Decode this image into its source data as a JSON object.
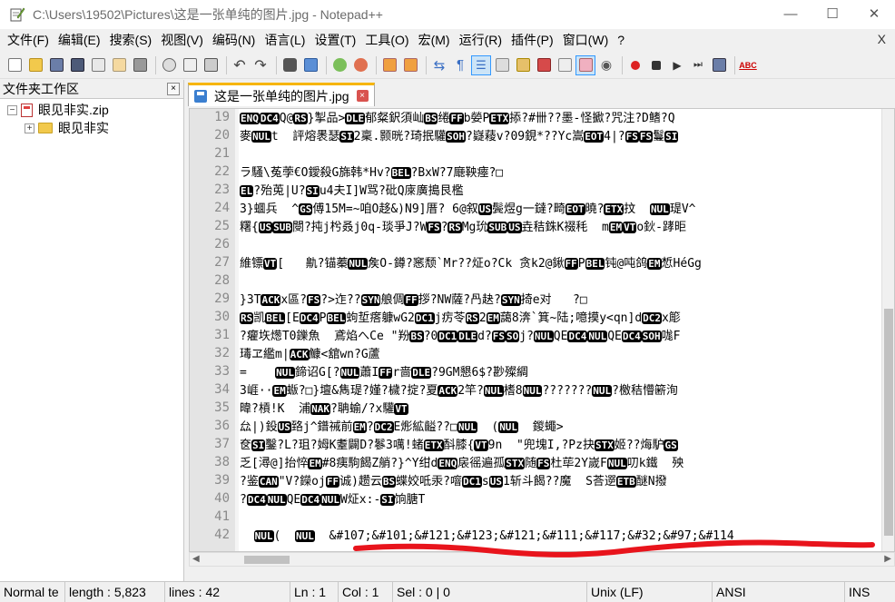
{
  "window": {
    "title": "C:\\Users\\19502\\Pictures\\这是一张单纯的图片.jpg - Notepad++",
    "minimize": "—",
    "maximize": "☐",
    "close": "✕"
  },
  "menu": {
    "items": [
      "文件(F)",
      "编辑(E)",
      "搜索(S)",
      "视图(V)",
      "编码(N)",
      "语言(L)",
      "设置(T)",
      "工具(O)",
      "宏(M)",
      "运行(R)",
      "插件(P)",
      "窗口(W)",
      "?"
    ],
    "close": "X"
  },
  "toolbar": {
    "icons": [
      "new-file-icon",
      "open-file-icon",
      "save-icon",
      "save-all-icon",
      "close-icon",
      "close-all-icon",
      "print-icon",
      "cut-icon",
      "copy-icon",
      "paste-icon",
      "undo-icon",
      "redo-icon",
      "find-icon",
      "replace-icon",
      "zoom-in-icon",
      "zoom-out-icon",
      "sync-vertical-icon",
      "sync-horizontal-icon",
      "word-wrap-icon",
      "show-all-chars-icon",
      "indent-guide-icon",
      "language-icon",
      "document-map-icon",
      "function-list-icon",
      "folder-workspace-icon",
      "monitor-icon",
      "record-macro-icon",
      "stop-macro-icon",
      "play-macro-icon",
      "run-macro-multiple-icon",
      "save-macro-icon",
      "spell-check-icon"
    ],
    "spell_label": "ABC"
  },
  "left_panel": {
    "title": "文件夹工作区",
    "close": "×",
    "tree": [
      {
        "label": "眼见非实.zip",
        "expander": "−",
        "type": "zip"
      },
      {
        "label": "眼见非实",
        "expander": "+",
        "type": "folder"
      }
    ]
  },
  "tab": {
    "label": "这是一张单纯的图片.jpg",
    "close": "×"
  },
  "editor": {
    "line_numbers": [
      "19",
      "20",
      "21",
      "22",
      "23",
      "24",
      "25",
      "26",
      "27",
      "28",
      "29",
      "30",
      "31",
      "32",
      "33",
      "34",
      "35",
      "36",
      "37",
      "38",
      "39",
      "40",
      "41",
      "42"
    ],
    "lines": [
      [
        {
          "t": "ENQ",
          "c": 1
        },
        {
          "t": "DC4",
          "c": 1
        },
        {
          "t": "Q@"
        },
        {
          "t": "RS",
          "c": 1
        },
        {
          "t": "}掣品>"
        },
        {
          "t": "DLE",
          "c": 1
        },
        {
          "t": "郁粲鈬須屾"
        },
        {
          "t": "BS",
          "c": 1
        },
        {
          "t": "绻"
        },
        {
          "t": "FF",
          "c": 1
        },
        {
          "t": "b嫈P"
        },
        {
          "t": "ETX",
          "c": 1
        },
        {
          "t": "掭?#卌??墨-怪擨?咒注?D鳍?Q"
        }
      ],
      [
        {
          "t": "麥"
        },
        {
          "t": "NUL",
          "c": 1
        },
        {
          "t": "t  評熔褁瑟"
        },
        {
          "t": "SI",
          "c": 1
        },
        {
          "t": "2稟.颢晄?琦抿驩"
        },
        {
          "t": "SOH",
          "c": 1
        },
        {
          "t": "?嶷薐v?09鋧*??Yc嵩"
        },
        {
          "t": "EOT",
          "c": 1
        },
        {
          "t": "4|?"
        },
        {
          "t": "FS",
          "c": 1
        },
        {
          "t": "FS",
          "c": 1
        },
        {
          "t": "鬘"
        },
        {
          "t": "SI",
          "c": 1
        }
      ],
      [],
      [
        {
          "t": "ラ騷\\菟荸€O鑀殺G旆韩*Hv?"
        },
        {
          "t": "BEL",
          "c": 1
        },
        {
          "t": "?BxW?7廰鞅瘞?□"
        }
      ],
      [
        {
          "t": "EL",
          "c": 1
        },
        {
          "t": "?殆莵|U?"
        },
        {
          "t": "SI",
          "c": 1
        },
        {
          "t": "u4夫I]W骂?砒Q庲廣搗艮檻"
        }
      ],
      [
        {
          "t": "3}蜖兵  ^"
        },
        {
          "t": "GS",
          "c": 1
        },
        {
          "t": "傅15M=~咱O趍&)N9]厝? 6@叙"
        },
        {
          "t": "US",
          "c": 1
        },
        {
          "t": "鬓煜g一鐽?畸"
        },
        {
          "t": "EOT",
          "c": 1
        },
        {
          "t": "曉?"
        },
        {
          "t": "ETX",
          "c": 1
        },
        {
          "t": "抆  "
        },
        {
          "t": "NUL",
          "c": 1
        },
        {
          "t": "瑅V^"
        }
      ],
      [
        {
          "t": "糬{"
        },
        {
          "t": "US",
          "c": 1
        },
        {
          "t": "SUB",
          "c": 1
        },
        {
          "t": "閿?扽j枍叒j0q-琰爭J?W"
        },
        {
          "t": "FS",
          "c": 1
        },
        {
          "t": "?"
        },
        {
          "t": "RS",
          "c": 1
        },
        {
          "t": "Mg玧"
        },
        {
          "t": "SUB",
          "c": 1
        },
        {
          "t": "US",
          "c": 1
        },
        {
          "t": "垚秸銖K裰秏  m"
        },
        {
          "t": "EM",
          "c": 1
        },
        {
          "t": "VT",
          "c": 1
        },
        {
          "t": "o鈥-踍昛"
        }
      ],
      [],
      [
        {
          "t": "維镖"
        },
        {
          "t": "VT",
          "c": 1
        },
        {
          "t": "[   鼽?锚蓁"
        },
        {
          "t": "NUL",
          "c": 1
        },
        {
          "t": "矦O-鐏?窸颓`Mr??炡o?Ck 贪k2@鍬"
        },
        {
          "t": "FF",
          "c": 1
        },
        {
          "t": "P"
        },
        {
          "t": "BEL",
          "c": 1
        },
        {
          "t": "钝@吨鸽"
        },
        {
          "t": "EM",
          "c": 1
        },
        {
          "t": "惁HéGg"
        }
      ],
      [],
      [
        {
          "t": "}3T"
        },
        {
          "t": "ACK",
          "c": 1
        },
        {
          "t": "x區?"
        },
        {
          "t": "FS",
          "c": 1
        },
        {
          "t": "?>迮??"
        },
        {
          "t": "SYN",
          "c": 1
        },
        {
          "t": "艆倜"
        },
        {
          "t": "FF",
          "c": 1
        },
        {
          "t": "拶?NW薩?冎赽?"
        },
        {
          "t": "SYN",
          "c": 1
        },
        {
          "t": "掎e对   ?□"
        }
      ],
      [
        {
          "t": "RS",
          "c": 1
        },
        {
          "t": "凯"
        },
        {
          "t": "BEL",
          "c": 1
        },
        {
          "t": "[E"
        },
        {
          "t": "DC4",
          "c": 1
        },
        {
          "t": "P"
        },
        {
          "t": "BEL",
          "c": 1
        },
        {
          "t": "蚼埑瘩躿wG2"
        },
        {
          "t": "DC1",
          "c": 1
        },
        {
          "t": "j疠苓"
        },
        {
          "t": "RS",
          "c": 1
        },
        {
          "t": "2"
        },
        {
          "t": "EM",
          "c": 1
        },
        {
          "t": "藹8渀`箕~陆;噫摸y<qn]d"
        },
        {
          "t": "DC2",
          "c": 1
        },
        {
          "t": "x簓"
        }
      ],
      [
        {
          "t": "?癯垁燪T0鑠魚  鳶焰へCe \"羒"
        },
        {
          "t": "BS",
          "c": 1
        },
        {
          "t": "?0"
        },
        {
          "t": "DC1",
          "c": 1
        },
        {
          "t": "DLE",
          "c": 1
        },
        {
          "t": "d?"
        },
        {
          "t": "FS",
          "c": 1
        },
        {
          "t": "SO",
          "c": 1
        },
        {
          "t": "j?"
        },
        {
          "t": "NUL",
          "c": 1
        },
        {
          "t": "QE"
        },
        {
          "t": "DC4",
          "c": 1
        },
        {
          "t": "NUL",
          "c": 1
        },
        {
          "t": "QE"
        },
        {
          "t": "DC4",
          "c": 1
        },
        {
          "t": "SOH",
          "c": 1
        },
        {
          "t": "哤F"
        }
      ],
      [
        {
          "t": "瑇ヱ繿m|"
        },
        {
          "t": "ACK",
          "c": 1
        },
        {
          "t": "鱇<舘wn?G蘆"
        }
      ],
      [
        {
          "t": "=    "
        },
        {
          "t": "NUL",
          "c": 1
        },
        {
          "t": "鍗诏G[?"
        },
        {
          "t": "NUL",
          "c": 1
        },
        {
          "t": "蕭I"
        },
        {
          "t": "FF",
          "c": 1
        },
        {
          "t": "r啬"
        },
        {
          "t": "DLE",
          "c": 1
        },
        {
          "t": "?9GM懇6$?尠殩綢"
        }
      ],
      [
        {
          "t": "3崕··"
        },
        {
          "t": "EM",
          "c": 1
        },
        {
          "t": "蝂?□}壇&雋瑅?嫤?檅?掟?夏"
        },
        {
          "t": "ACK",
          "c": 1
        },
        {
          "t": "2竿?"
        },
        {
          "t": "NUL",
          "c": 1
        },
        {
          "t": "榰8"
        },
        {
          "t": "NUL",
          "c": 1
        },
        {
          "t": "???????"
        },
        {
          "t": "NUL",
          "c": 1
        },
        {
          "t": "?檄秸懵簖洵"
        }
      ],
      [
        {
          "t": "暐?槓!K  浦"
        },
        {
          "t": "NAK",
          "c": 1
        },
        {
          "t": "?聃蝓/?x驩"
        },
        {
          "t": "VT",
          "c": 1
        }
      ],
      [
        {
          "t": "厽|)鈠"
        },
        {
          "t": "US",
          "c": 1
        },
        {
          "t": "臵j^鐠祴前"
        },
        {
          "t": "EM",
          "c": 1
        },
        {
          "t": "?"
        },
        {
          "t": "DC2",
          "c": 1
        },
        {
          "t": "E烿絋齸??□"
        },
        {
          "t": "NUL",
          "c": 1
        },
        {
          "t": "  ("
        },
        {
          "t": "NUL",
          "c": 1
        },
        {
          "t": "  鍐蠅>"
        }
      ],
      [
        {
          "t": "奁"
        },
        {
          "t": "SI",
          "c": 1
        },
        {
          "t": "鑿?L?珇?姆K耋闢D?鬖3噧!蝫"
        },
        {
          "t": "ETX",
          "c": 1
        },
        {
          "t": "酙膝{"
        },
        {
          "t": "VT",
          "c": 1
        },
        {
          "t": "9n  \"兜塊I,?Pz抉"
        },
        {
          "t": "STX",
          "c": 1
        },
        {
          "t": "姬??烸馿"
        },
        {
          "t": "GS",
          "c": 1
        }
      ],
      [
        {
          "t": "乏[潯@]抬悴"
        },
        {
          "t": "EM",
          "c": 1
        },
        {
          "t": "#8痍駒餲Z艄?}^Y绀d"
        },
        {
          "t": "ENQ",
          "c": 1
        },
        {
          "t": "扆徭遍孤"
        },
        {
          "t": "STX",
          "c": 1
        },
        {
          "t": "随"
        },
        {
          "t": "FS",
          "c": 1
        },
        {
          "t": "杜荜2Y嵗F"
        },
        {
          "t": "NUL",
          "c": 1
        },
        {
          "t": "叨k鐵  殃"
        }
      ],
      [
        {
          "t": "?鉴"
        },
        {
          "t": "CAN",
          "c": 1
        },
        {
          "t": "\"V?鑅oj"
        },
        {
          "t": "FF",
          "c": 1
        },
        {
          "t": "诚)趱云"
        },
        {
          "t": "BS",
          "c": 1
        },
        {
          "t": "蝶姣呧汞?噾"
        },
        {
          "t": "DC1",
          "c": 1
        },
        {
          "t": "s"
        },
        {
          "t": "US",
          "c": 1
        },
        {
          "t": "1斩斗餲??魔  S荅遻"
        },
        {
          "t": "ETB",
          "c": 1
        },
        {
          "t": "醚N撥"
        }
      ],
      [
        {
          "t": "?"
        },
        {
          "t": "DC4",
          "c": 1
        },
        {
          "t": "NUL",
          "c": 1
        },
        {
          "t": "QE"
        },
        {
          "t": "DC4",
          "c": 1
        },
        {
          "t": "NUL",
          "c": 1
        },
        {
          "t": "W炡x:-"
        },
        {
          "t": "SI",
          "c": 1
        },
        {
          "t": "饷膅T"
        }
      ],
      [],
      [
        {
          "t": "  "
        },
        {
          "t": "NUL",
          "c": 1
        },
        {
          "t": "(  "
        },
        {
          "t": "NUL",
          "c": 1
        },
        {
          "t": "  &#107;&#101;&#121;&#123;&#121;&#111;&#117;&#32;&#97;&#114"
        }
      ]
    ]
  },
  "status": {
    "type": "Normal te",
    "length": "length : 5,823",
    "lines": "lines : 42",
    "ln": "Ln : 1",
    "col": "Col : 1",
    "sel": "Sel : 0 | 0",
    "eol": "Unix (LF)",
    "encoding": "ANSI",
    "mode": "INS"
  },
  "colors": {
    "annotation": "#e8141c",
    "tab_accent": "#f7b500",
    "gutter": "#e4e4e4"
  }
}
